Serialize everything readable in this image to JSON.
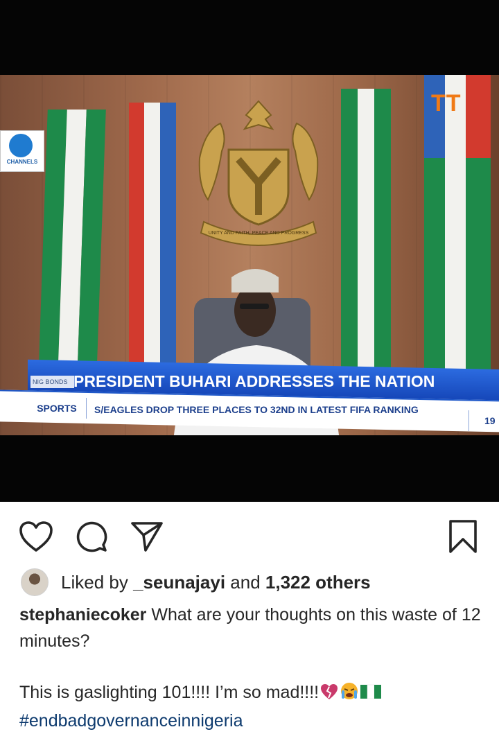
{
  "post_image": {
    "channel_logo_text": "CHANNELS",
    "headline_tag": "NIG BONDS",
    "headline": "PRESIDENT BUHARI ADDRESSES THE NATION",
    "ticker_category": "SPORTS",
    "ticker_text": "S/EAGLES DROP THREE PLACES TO 32ND IN LATEST FIFA RANKING",
    "ticker_number": "19",
    "crest_motto": "UNITY AND FAITH, PEACE AND PROGRESS"
  },
  "actions": {
    "like_icon": "heart-icon",
    "comment_icon": "comment-icon",
    "share_icon": "paper-plane-icon",
    "save_icon": "bookmark-icon"
  },
  "likes": {
    "prefix": "Liked by ",
    "liker": "_seunajayi",
    "middle": " and ",
    "others": "1,322 others"
  },
  "caption": {
    "username": "stephaniecoker",
    "line1": " What are your thoughts on this waste of 12 minutes?",
    "line2": "This is gaslighting 101!!!! I’m so mad!!!!",
    "emojis": [
      "broken-heart-icon",
      "crying-face-icon",
      "nigeria-flag-icon"
    ],
    "hashtag": "#endbadgovernanceinnigeria"
  },
  "colors": {
    "text": "#262626",
    "hashtag": "#0d3a6e",
    "headline_bar": "#1c56c8",
    "nigeria_green": "#1e8a4a"
  }
}
